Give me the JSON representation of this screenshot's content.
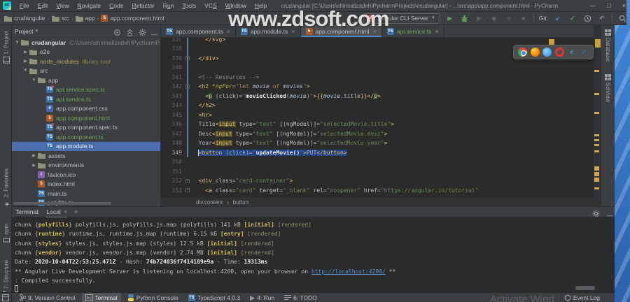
{
  "window": {
    "app_icon_text": "PC",
    "menus": [
      {
        "label": "File",
        "m": 0
      },
      {
        "label": "Edit",
        "m": 0
      },
      {
        "label": "View",
        "m": 0
      },
      {
        "label": "Navigate",
        "m": 0
      },
      {
        "label": "Code",
        "m": 0
      },
      {
        "label": "Refactor",
        "m": 0
      },
      {
        "label": "Run",
        "m": 1
      },
      {
        "label": "Tools",
        "m": 0
      },
      {
        "label": "VCS",
        "m": 2
      },
      {
        "label": "Window",
        "m": 0
      },
      {
        "label": "Help",
        "m": 0
      }
    ],
    "title": "crudangular [C:\\Users\\shirinalizadeh\\PycharmProjects\\crudangular] - ...\\src\\app\\app.component.html - PyCharm"
  },
  "toolbar": {
    "breadcrumbs": [
      {
        "label": "crudangular",
        "icon": "folder"
      },
      {
        "label": "src",
        "icon": "folder"
      },
      {
        "label": "app",
        "icon": "folder"
      },
      {
        "label": "app.component.html",
        "icon": "html"
      }
    ],
    "run_config": "Angular CLI Server",
    "git_label": "Git:"
  },
  "watermark": "www.zdsoft.com",
  "activate_watermark": "Activate Wind",
  "left_bar": {
    "top": [
      {
        "label": "1: Project",
        "icon": "winbox"
      }
    ],
    "bottom": [
      {
        "label": "2: Favorites",
        "icon": "star"
      },
      {
        "label": "npm",
        "icon": "npmbox"
      },
      {
        "label": "7: Structure",
        "icon": "structure"
      }
    ]
  },
  "right_bar": [
    {
      "label": "Database",
      "icon": "grid"
    },
    {
      "label": "SciView",
      "icon": "grid"
    }
  ],
  "project": {
    "header": "Project",
    "tree": [
      {
        "level": 0,
        "arrow": "open",
        "icon": "folder",
        "label": "crudangular",
        "bold": true,
        "sub": "C:\\Users\\shirinalizadeh\\PycharmProjects\\crudangular"
      },
      {
        "level": 1,
        "arrow": "closed",
        "icon": "folder",
        "label": "e2e"
      },
      {
        "level": 1,
        "arrow": "closed",
        "icon": "folder",
        "label": "node_modules",
        "color": "olive",
        "sub": "library root",
        "subcolor": "olive"
      },
      {
        "level": 1,
        "arrow": "open",
        "icon": "folder",
        "label": "src"
      },
      {
        "level": 2,
        "arrow": "open",
        "icon": "folder",
        "label": "app"
      },
      {
        "level": 3,
        "icon": "spec",
        "label": "api.service.spec.ts",
        "color": "green"
      },
      {
        "level": 3,
        "icon": "ts",
        "label": "api.service.ts",
        "color": "green"
      },
      {
        "level": 3,
        "icon": "css",
        "label": "app.component.css"
      },
      {
        "level": 3,
        "icon": "html",
        "label": "app.component.html",
        "color": "green"
      },
      {
        "level": 3,
        "icon": "spec",
        "label": "app.component.spec.ts"
      },
      {
        "level": 3,
        "icon": "ts",
        "label": "app.component.ts",
        "color": "green"
      },
      {
        "level": 3,
        "icon": "ts",
        "label": "app.module.ts",
        "selected": true
      },
      {
        "level": 2,
        "arrow": "closed",
        "icon": "folder",
        "label": "assets"
      },
      {
        "level": 2,
        "arrow": "closed",
        "icon": "folder",
        "label": "environments"
      },
      {
        "level": 2,
        "icon": "ico",
        "label": "favicon.ico"
      },
      {
        "level": 2,
        "icon": "html",
        "label": "index.html"
      },
      {
        "level": 2,
        "icon": "ts",
        "label": "main.ts"
      },
      {
        "level": 2,
        "icon": "ts",
        "label": "polyfills.ts"
      }
    ]
  },
  "editor": {
    "tabs": [
      {
        "label": "app.component.ts",
        "icon": "ts"
      },
      {
        "label": "app.module.ts",
        "icon": "ts"
      },
      {
        "label": "app.component.html",
        "icon": "html",
        "active": true
      },
      {
        "label": "api.service.ts",
        "icon": "ts",
        "color": "green"
      }
    ],
    "breadcrumb": [
      "div.content",
      "button"
    ],
    "lines": [
      {
        "n": 337,
        "tk": [
          [
            "x",
            "    "
          ],
          [
            "t",
            "</svg>"
          ]
        ]
      },
      {
        "n": 338,
        "tk": []
      },
      {
        "n": 339,
        "fold": true,
        "tk": [
          [
            "x",
            "  "
          ],
          [
            "t",
            "</div>"
          ]
        ]
      },
      {
        "n": 340,
        "tk": []
      },
      {
        "n": 341,
        "tk": [
          [
            "x",
            "  "
          ],
          [
            "c",
            "<!-- Resources -->"
          ]
        ]
      },
      {
        "n": 342,
        "fold": true,
        "tk": [
          [
            "x",
            "  "
          ],
          [
            "t",
            "<h2 "
          ],
          [
            "d",
            "*ngFor"
          ],
          [
            "x",
            "="
          ],
          [
            "s",
            "\""
          ],
          [
            "k",
            "let "
          ],
          [
            "v",
            "movie"
          ],
          [
            "k",
            " of "
          ],
          [
            "x",
            "movies"
          ],
          [
            "s",
            "\""
          ],
          [
            "t",
            ">"
          ]
        ]
      },
      {
        "n": 343,
        "tk": [
          [
            "x",
            "    "
          ],
          [
            "t",
            "<"
          ],
          [
            "tm",
            "p"
          ],
          [
            "x",
            " ("
          ],
          [
            "a",
            "click"
          ],
          [
            "x",
            ")="
          ],
          [
            "s",
            "\""
          ],
          [
            "f",
            "movieClicked"
          ],
          [
            "x",
            "("
          ],
          [
            "v",
            "movie"
          ],
          [
            "x",
            ")"
          ],
          [
            "s",
            "\""
          ],
          [
            "t",
            ">"
          ],
          [
            "t",
            "{{"
          ],
          [
            "v",
            "movie"
          ],
          [
            "x",
            ".title"
          ],
          [
            "t",
            "}}"
          ],
          [
            "t",
            "</"
          ],
          [
            "tm",
            "p"
          ],
          [
            "t",
            ">"
          ]
        ]
      },
      {
        "n": 344,
        "tk": [
          [
            "x",
            "  "
          ],
          [
            "t",
            "</h2>"
          ]
        ]
      },
      {
        "n": 345,
        "tk": [
          [
            "x",
            "  "
          ],
          [
            "t",
            "<hr>"
          ]
        ]
      },
      {
        "n": 346,
        "tk": [
          [
            "x",
            "  Title"
          ],
          [
            "t",
            "<"
          ],
          [
            "hi",
            "input"
          ],
          [
            "x",
            " "
          ],
          [
            "a",
            "type"
          ],
          [
            "x",
            "="
          ],
          [
            "s",
            "\"text\""
          ],
          [
            "x",
            " ["
          ],
          [
            "a",
            "(ngModel)"
          ],
          [
            "x",
            "]="
          ],
          [
            "s",
            "\"selectedMovie.title\""
          ],
          [
            "t",
            ">"
          ]
        ]
      },
      {
        "n": 347,
        "tk": [
          [
            "x",
            "  Desc"
          ],
          [
            "t",
            "<"
          ],
          [
            "hi",
            "input"
          ],
          [
            "x",
            " "
          ],
          [
            "a",
            "type"
          ],
          [
            "x",
            "="
          ],
          [
            "s",
            "\"text\""
          ],
          [
            "x",
            " ["
          ],
          [
            "a",
            "(ngModel)"
          ],
          [
            "x",
            "]="
          ],
          [
            "s",
            "\"selectedMovie.desc\""
          ],
          [
            "t",
            ">"
          ]
        ]
      },
      {
        "n": 348,
        "tk": [
          [
            "x",
            "  Year"
          ],
          [
            "t",
            "<"
          ],
          [
            "hi",
            "input"
          ],
          [
            "x",
            " "
          ],
          [
            "a",
            "type"
          ],
          [
            "x",
            "="
          ],
          [
            "s",
            "\"text\""
          ],
          [
            "x",
            " ["
          ],
          [
            "a",
            "(ngModel)"
          ],
          [
            "x",
            "]="
          ],
          [
            "s",
            "\"selectedMovie.year\""
          ],
          [
            "t",
            ">"
          ]
        ]
      },
      {
        "n": 349,
        "selected": true,
        "tk": [
          [
            "x",
            "  "
          ],
          [
            "t",
            "<button"
          ],
          [
            "x",
            " ("
          ],
          [
            "a",
            "click"
          ],
          [
            "x",
            ")="
          ],
          [
            "s",
            "\""
          ],
          [
            "f",
            "updateMovie()"
          ],
          [
            "s",
            "\""
          ],
          [
            "t",
            ">"
          ],
          [
            "x",
            "PUT"
          ],
          [
            "t",
            "</button>"
          ]
        ]
      },
      {
        "n": 350,
        "tk": []
      },
      {
        "n": 351,
        "tk": []
      },
      {
        "n": 352,
        "fold": true,
        "tk": [
          [
            "x",
            "  "
          ],
          [
            "t",
            "<div "
          ],
          [
            "a",
            "class"
          ],
          [
            "x",
            "="
          ],
          [
            "s",
            "\"card-container\""
          ],
          [
            "t",
            ">"
          ]
        ]
      },
      {
        "n": 353,
        "fold": true,
        "tk": [
          [
            "x",
            "    "
          ],
          [
            "t",
            "<a "
          ],
          [
            "a",
            "class"
          ],
          [
            "x",
            "="
          ],
          [
            "s",
            "\"card\""
          ],
          [
            "x",
            " "
          ],
          [
            "a",
            "target"
          ],
          [
            "x",
            "="
          ],
          [
            "s",
            "\"_blank\""
          ],
          [
            "x",
            " "
          ],
          [
            "a",
            "rel"
          ],
          [
            "x",
            "="
          ],
          [
            "s",
            "\"noopener\""
          ],
          [
            "x",
            " "
          ],
          [
            "a",
            "href"
          ],
          [
            "x",
            "="
          ],
          [
            "s",
            "\"https://angular.io/tutorial\""
          ]
        ]
      }
    ],
    "stripe_marks": [
      {
        "t": 64,
        "h": 3
      },
      {
        "t": 97,
        "h": 3
      },
      {
        "t": 124,
        "h": 3
      },
      {
        "t": 156,
        "h": 3
      },
      {
        "t": 163,
        "h": 3
      },
      {
        "t": 170,
        "h": 3
      },
      {
        "t": 179,
        "h": 3
      },
      {
        "t": 202,
        "h": 6
      },
      {
        "t": 210,
        "h": 6
      },
      {
        "t": 218,
        "h": 6
      },
      {
        "t": 232,
        "h": 3
      }
    ]
  },
  "browser_bar": [
    "chrome",
    "firefox",
    "safari",
    "opera",
    "ie",
    "edge"
  ],
  "terminal": {
    "label": "Terminal:",
    "tab": "Local",
    "lines": [
      [
        [
          "w",
          "chunk {"
        ],
        [
          "y",
          "polyfills"
        ],
        [
          "w",
          "} polyfills.js, polyfills.js.map (polyfills) 141 kB "
        ],
        [
          "y",
          "[initial]"
        ],
        [
          "w",
          " "
        ],
        [
          "g",
          "[rendered]"
        ]
      ],
      [
        [
          "w",
          "chunk {"
        ],
        [
          "y",
          "runtime"
        ],
        [
          "w",
          "} runtime.js, runtime.js.map (runtime) 6.15 kB "
        ],
        [
          "y",
          "[entry]"
        ],
        [
          "w",
          " "
        ],
        [
          "g",
          "[rendered]"
        ]
      ],
      [
        [
          "w",
          "chunk {"
        ],
        [
          "y",
          "styles"
        ],
        [
          "w",
          "} styles.js, styles.js.map (styles) 12.5 kB "
        ],
        [
          "y",
          "[initial]"
        ],
        [
          "w",
          " "
        ],
        [
          "g",
          "[rendered]"
        ]
      ],
      [
        [
          "w",
          "chunk {"
        ],
        [
          "y",
          "vendor"
        ],
        [
          "w",
          "} vendor.js, vendor.js.map (vendor) 2.74 MB "
        ],
        [
          "y",
          "[initial]"
        ],
        [
          "w",
          " "
        ],
        [
          "g",
          "[rendered]"
        ]
      ],
      [
        [
          "w",
          "Date: "
        ],
        [
          "b",
          "2020-10-04T22:53:25.471Z"
        ],
        [
          "w",
          " - Hash: "
        ],
        [
          "b",
          "74b724036f7414189e9a"
        ],
        [
          "w",
          " - Time: "
        ],
        [
          "b",
          "19313ms"
        ]
      ],
      [
        [
          "w",
          "** Angular Live Development Server is listening on localhost:4200, open your browser on "
        ],
        [
          "l",
          "http://localhost:4200/"
        ],
        [
          "w",
          " **"
        ]
      ],
      [
        [
          "w",
          ": Compiled successfully."
        ]
      ]
    ]
  },
  "status_bar": {
    "left": [
      {
        "label": "9: Version Control",
        "icon": "branch"
      },
      {
        "label": "Terminal",
        "icon": "term",
        "active": true
      },
      {
        "label": "Python Console",
        "icon": "python"
      },
      {
        "label": "TypeScript 4.0.3",
        "icon": "tsbadge"
      },
      {
        "label": "4: Run",
        "icon": "runsmall"
      },
      {
        "label": "6: TODO",
        "icon": "todo"
      }
    ],
    "right": [
      {
        "label": "Event Log",
        "icon": "event"
      }
    ]
  },
  "colors": {
    "accent_blue": "#4a88c7",
    "selection_blue": "#214283",
    "tree_selection": "#4b6eaf",
    "added_green": "#73a45a",
    "tag_yellow": "#e8bf6a",
    "string_green": "#6a8759",
    "terminal_yellow": "#d6bf55",
    "link_blue": "#5394ce",
    "stripe_yellow": "#d9a343",
    "desktop_blue": "#2a62ad"
  }
}
